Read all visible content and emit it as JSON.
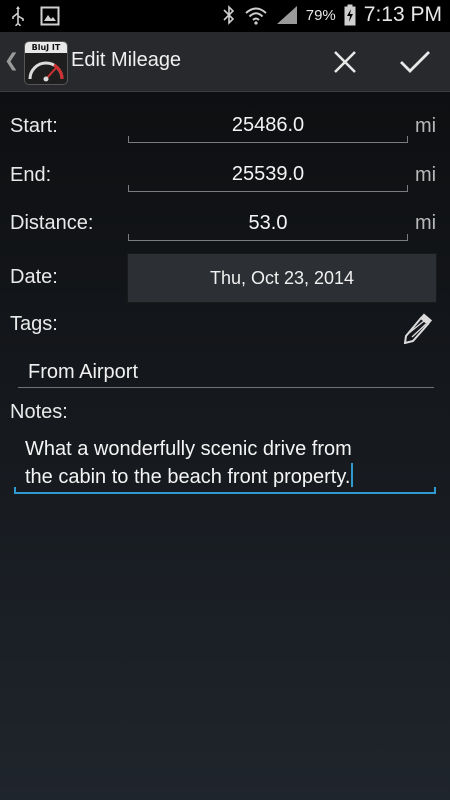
{
  "status_bar": {
    "battery_percent": "79%",
    "time": "7:13 PM",
    "icons": [
      "usb-icon",
      "image-icon",
      "bluetooth-icon",
      "wifi-icon",
      "signal-icon",
      "battery-charging-icon"
    ]
  },
  "action_bar": {
    "title": "Edit Mileage",
    "logo_text": "BluJ IT",
    "close_icon": "close-icon",
    "done_icon": "check-icon"
  },
  "form": {
    "start": {
      "label": "Start:",
      "value": "25486.0",
      "unit": "mi"
    },
    "end": {
      "label": "End:",
      "value": "25539.0",
      "unit": "mi"
    },
    "distance": {
      "label": "Distance:",
      "value": "53.0",
      "unit": "mi"
    },
    "date": {
      "label": "Date:",
      "value": "Thu, Oct 23, 2014"
    },
    "tags": {
      "label": "Tags:",
      "value": "From Airport"
    },
    "notes": {
      "label": "Notes:",
      "line1": "What a wonderfully scenic drive from",
      "line2": "the cabin to the beach front property."
    }
  },
  "colors": {
    "accent": "#2e9ad0",
    "actionbar": "#27292c"
  }
}
